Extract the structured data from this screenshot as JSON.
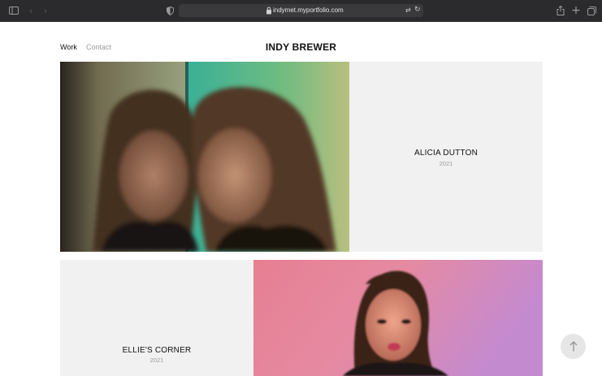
{
  "browser": {
    "url": "indymet.myportfolio.com",
    "icons": [
      "sidebar-icon",
      "back-arrow-icon",
      "forward-arrow-icon",
      "shield-icon",
      "lock-icon",
      "translate-icon",
      "reload-icon",
      "share-icon",
      "new-tab-icon",
      "tab-overview-icon"
    ]
  },
  "nav": {
    "work": "Work",
    "contact": "Contact"
  },
  "site_title": "INDY BREWER",
  "projects": [
    {
      "title": "ALICIA DUTTON",
      "year": "2021"
    },
    {
      "title": "ELLIE'S CORNER",
      "year": "2021"
    }
  ],
  "scroll_top_icon": "arrow-up-icon"
}
